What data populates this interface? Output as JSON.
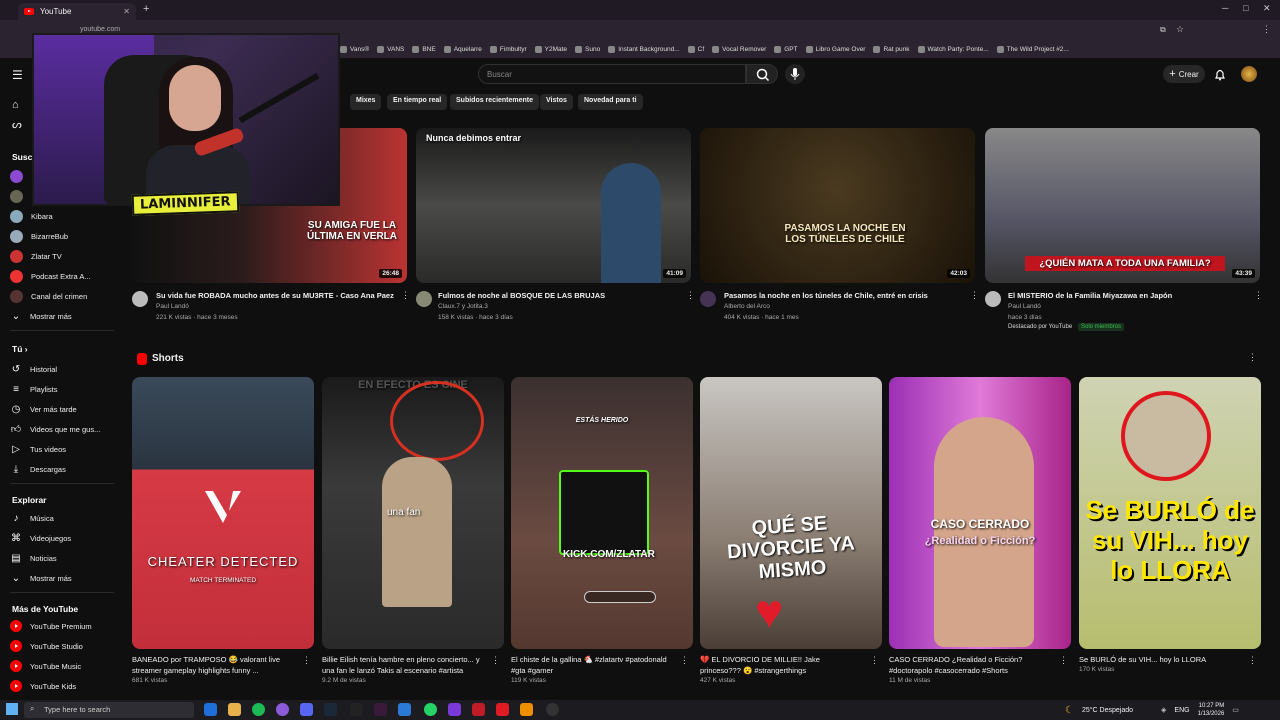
{
  "browser": {
    "tab_title": "YouTube",
    "url": "youtube.com",
    "bookmarks": [
      "Vans®",
      "VANS",
      "BNE",
      "Aquelarre",
      "Fimbultyr",
      "Y2Mate",
      "Suno",
      "Instant Background...",
      "Cf",
      "Vocal Remover",
      "GPT",
      "Libro Game Over",
      "Rat punk",
      "Watch Party: Ponte...",
      "The Wild Project #2..."
    ]
  },
  "overlay": {
    "streamer_label": "LAMINNIFER"
  },
  "header": {
    "search_placeholder": "Buscar",
    "create_label": "Crear"
  },
  "chips": [
    "Mixes",
    "En tiempo real",
    "Subidos recientemente",
    "Vistos",
    "Novedad para ti"
  ],
  "sidebar": {
    "subs_heading": "Suscr",
    "subscriptions": [
      "Kibara",
      "BizarreBub",
      "Zlatar TV",
      "Podcast Extra A...",
      "Canal del crimen"
    ],
    "show_more": "Mostrar más",
    "you_heading": "Tú",
    "you_items": [
      "Historial",
      "Playlists",
      "Ver más tarde",
      "Videos que me gus...",
      "Tus videos",
      "Descargas"
    ],
    "explore_heading": "Explorar",
    "explore_items": [
      "Música",
      "Videojuegos",
      "Noticias",
      "Mostrar más"
    ],
    "more_heading": "Más de YouTube",
    "more_items": [
      "YouTube Premium",
      "YouTube Studio",
      "YouTube Music",
      "YouTube Kids"
    ]
  },
  "videos": [
    {
      "title": "Su vida fue ROBADA mucho antes de su MU3RTE - Caso Ana Paez",
      "channel": "Paul Landó",
      "meta": "221 K vistas · hace 3 meses",
      "duration": "26:48",
      "overlay": "SU AMIGA FUE LA ÚLTIMA EN VERLA"
    },
    {
      "title": "Fulmos de noche al BOSQUE DE LAS BRUJAS",
      "channel": "Claux.7 y Jotita.3",
      "meta": "158 K vistas · hace 3 días",
      "duration": "41:09",
      "overlay": "Nunca debimos entrar"
    },
    {
      "title": "Pasamos la noche en los túneles de Chile, entré en crisis",
      "channel": "Alberto del Arco",
      "meta": "404 K vistas · hace 1 mes",
      "duration": "42:03",
      "overlay": "PASAMOS LA NOCHE EN LOS TÚNELES DE CHILE"
    },
    {
      "title": "El MISTERIO de la Familia Miyazawa en Japón",
      "channel": "Paul Landó",
      "meta": "hace 3 días",
      "duration": "43:39",
      "overlay": "¿QUIÉN MATA A TODA UNA FAMILIA?",
      "badge": "Destacado por YouTube",
      "badge2": "Solo miembros"
    }
  ],
  "shorts_heading": "Shorts",
  "shorts": [
    {
      "title": "BANEADO por TRAMPOSO 😂 valorant live streamer gameplay highlights funny ...",
      "views": "681 K vistas",
      "overlay": "CHEATER DETECTED",
      "overlay2": "MATCH TERMINATED"
    },
    {
      "title": "Billie Eilish tenía hambre en pleno concierto... y una fan le lanzó Takis al escenario #artista",
      "views": "9.2 M de vistas",
      "overlay": "EN EFECTO ES CINE",
      "overlay2": "una fan"
    },
    {
      "title": "El chiste de la gallina 🐔 #zlatartv #patodonald #gta #gamer",
      "views": "119 K vistas",
      "overlay": "ESTÁS HERIDO",
      "overlay2": "KICK.COM/ZLATAR"
    },
    {
      "title": "💔 EL DIVORCIO DE MILLIE!! Jake princeso??? 😮 #strangerthings",
      "views": "427 K vistas",
      "overlay": "QUÉ SE DIVORCIE YA MISMO"
    },
    {
      "title": "CASO CERRADO ¿Realidad o Ficción? #doctorapolo #casocerrado #Shorts",
      "views": "11 M de vistas",
      "overlay": "CASO CERRADO",
      "overlay2": "¿Realidad o Ficción?"
    },
    {
      "title": "Se BURLÓ de su VIH... hoy lo LLORA",
      "views": "170 K vistas",
      "overlay": "Se BURLÓ de su VIH... hoy lo LLORA"
    }
  ],
  "taskbar": {
    "search_placeholder": "Type here to search",
    "weather": "25°C Despejado",
    "lang": "ENG",
    "time": "10:27 PM",
    "date": "1/13/2026"
  }
}
